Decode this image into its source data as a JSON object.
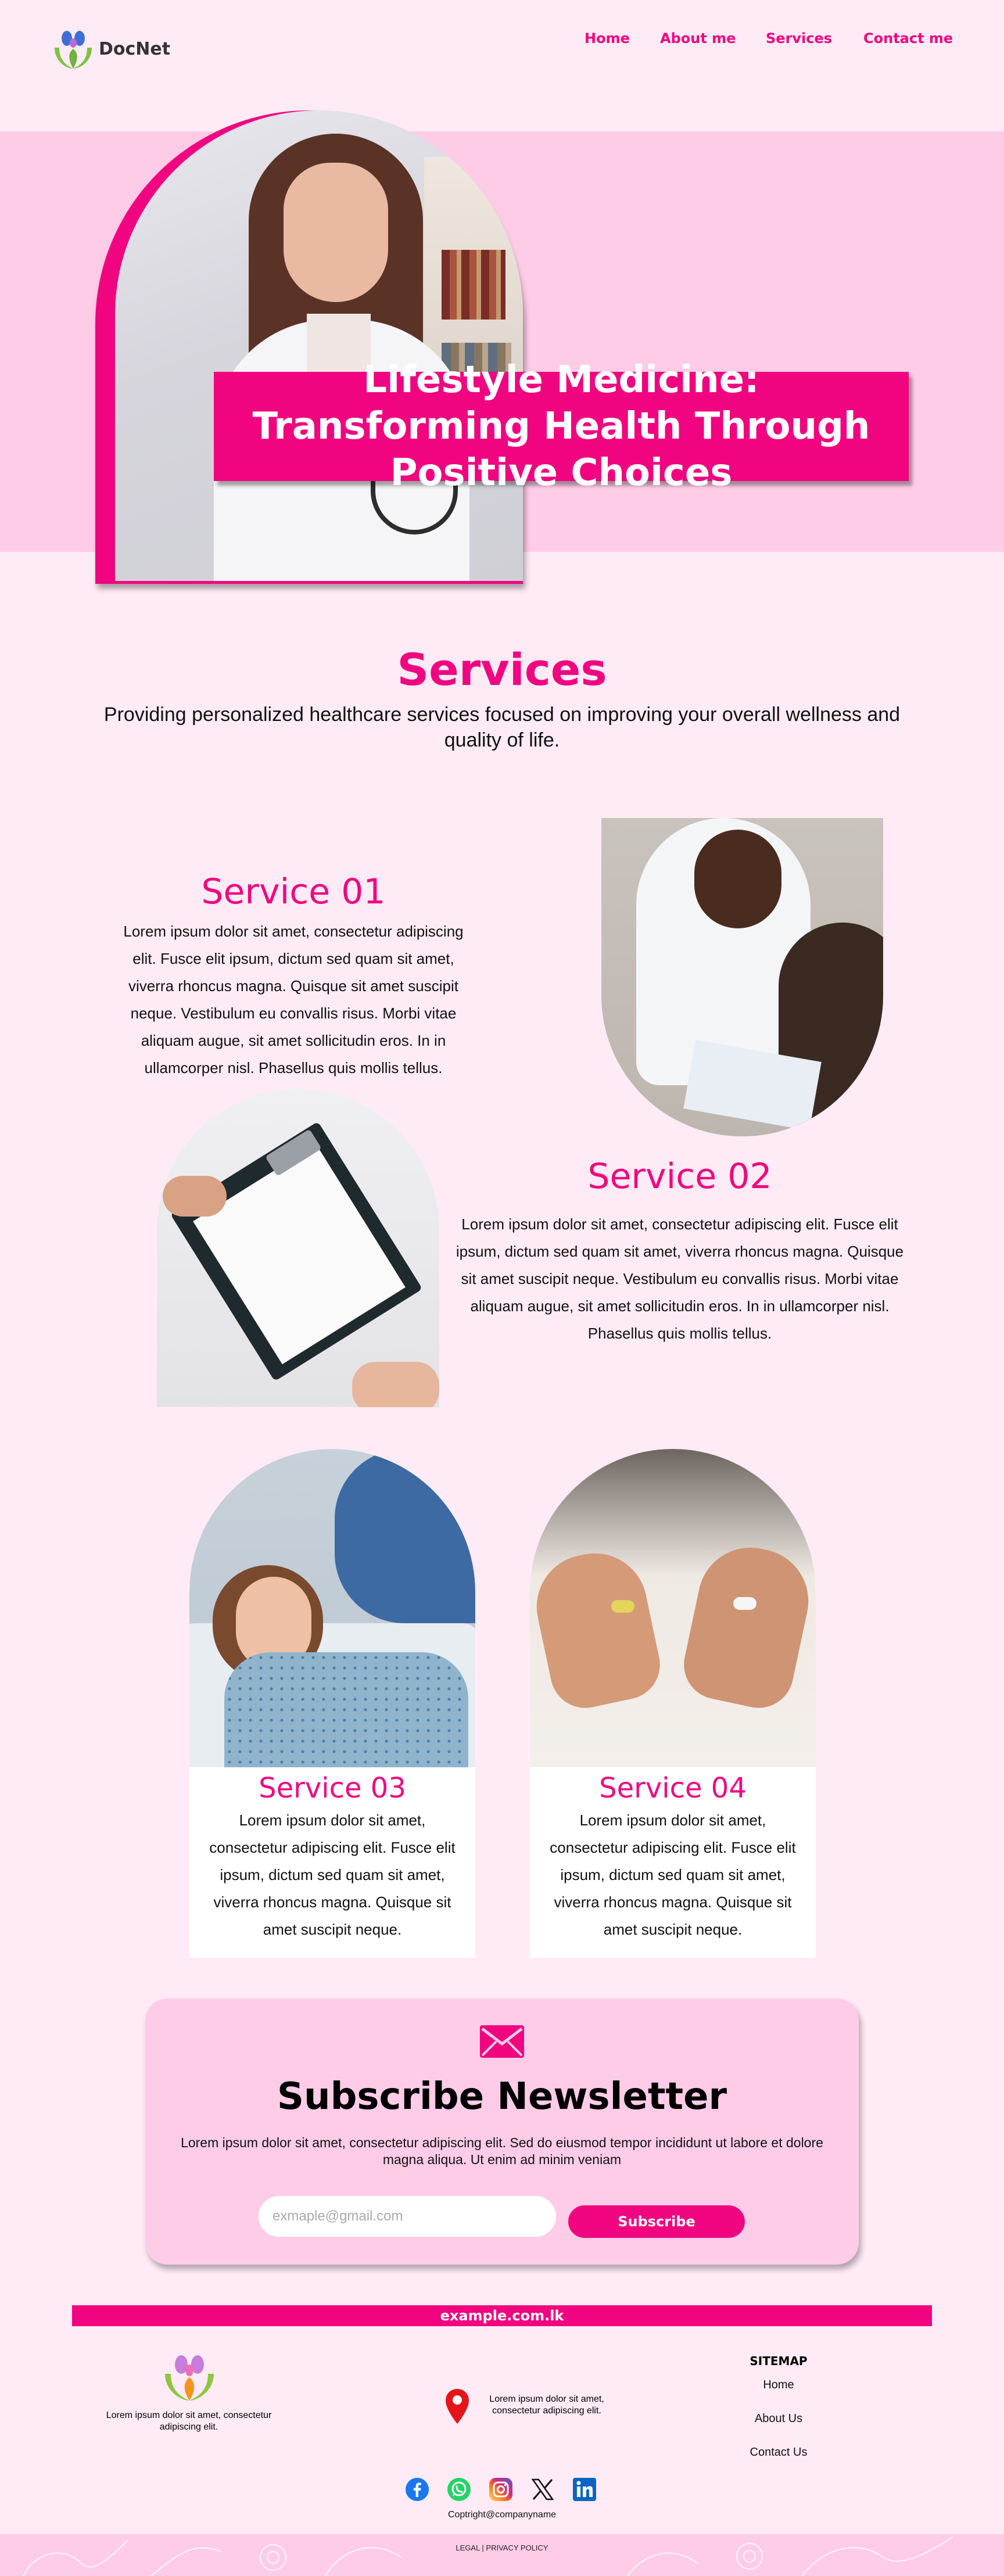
{
  "brand": {
    "name": "DocNet",
    "accent": "#F0047F",
    "light_pink": "#FFCCE7",
    "page_bg": "#FFEBF5"
  },
  "nav": {
    "items": [
      "Home",
      "About me",
      "Services",
      "Contact me"
    ]
  },
  "hero": {
    "title": "Lifestyle Medicine: Transforming Health Through Positive Choices"
  },
  "services": {
    "title": "Services",
    "subtitle": "Providing personalized healthcare services focused on improving your overall wellness and quality of life.",
    "items": [
      {
        "title": "Service 01",
        "text": "Lorem ipsum dolor sit amet, consectetur adipiscing elit. Fusce elit ipsum, dictum sed quam sit amet, viverra rhoncus magna. Quisque sit amet suscipit neque. Vestibulum eu convallis risus. Morbi vitae aliquam augue, sit amet sollicitudin eros. In in ullamcorper nisl. Phasellus quis mollis tellus."
      },
      {
        "title": "Service 02",
        "text": "Lorem ipsum dolor sit amet, consectetur adipiscing elit. Fusce elit ipsum, dictum sed quam sit amet, viverra rhoncus magna. Quisque sit amet suscipit neque. Vestibulum eu convallis risus. Morbi vitae aliquam augue, sit amet sollicitudin eros. In in ullamcorper nisl. Phasellus quis mollis tellus."
      },
      {
        "title": "Service 03",
        "text": "Lorem ipsum dolor sit amet, consectetur adipiscing elit. Fusce elit ipsum, dictum sed quam sit amet, viverra rhoncus magna. Quisque sit amet suscipit neque."
      },
      {
        "title": "Service 04",
        "text": "Lorem ipsum dolor sit amet, consectetur adipiscing elit. Fusce elit ipsum, dictum sed quam sit amet, viverra rhoncus magna. Quisque sit amet suscipit neque."
      }
    ]
  },
  "newsletter": {
    "icon": "mail-icon",
    "title": "Subscribe Newsletter",
    "text": "Lorem ipsum dolor sit amet, consectetur adipiscing elit. Sed do eiusmod tempor incididunt ut labore et dolore magna aliqua. Ut enim ad minim veniam",
    "placeholder": "exmaple@gmail.com",
    "button": "Subscribe"
  },
  "footer": {
    "domain": "example.com.lk",
    "description": "Lorem ipsum dolor sit amet, consectetur adipiscing elit.",
    "address": "Lorem ipsum dolor sit amet, consectetur adipiscing elit.",
    "sitemap_title": "SITEMAP",
    "sitemap_links": [
      "Home",
      "About Us",
      "Contact Us"
    ],
    "social_icons": [
      "facebook-icon",
      "whatsapp-icon",
      "instagram-icon",
      "x-icon",
      "linkedin-icon"
    ],
    "copyright": "Coptright@companyname",
    "legal": "LEGAL | PRIVACY POLICY"
  }
}
